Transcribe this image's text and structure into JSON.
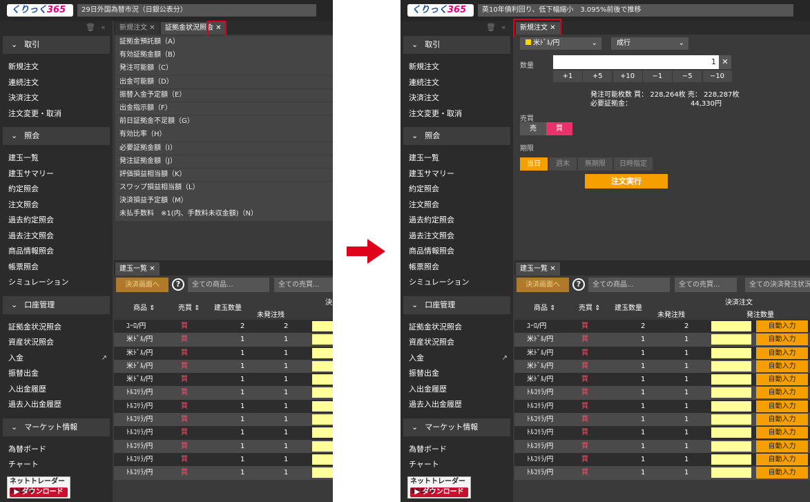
{
  "logo": {
    "brand": "くりっく",
    "num": "365"
  },
  "left": {
    "news": "29日外国為替市況（日銀公表分）",
    "tabs": [
      "新規注文",
      "証拠金状況照会"
    ],
    "columns": [
      "証拠金預託額（A）",
      "有効証拠金額（B）",
      "発注可能額（C）",
      "出金可能額（D）",
      "振替入金予定額（E）",
      "出金指示額（F）",
      "前日証拠金不足額（G）",
      "有効比率（H）",
      "必要証拠金額（I）",
      "発注証拠金額（J）",
      "評価損益相当額（K）",
      "スワップ損益相当額（L）",
      "決済損益予定額（M）",
      "未払手数料　※1(内、手数料未収金額)（N）"
    ],
    "toolbar": {
      "close_btn": "決済画面へ",
      "product": "全ての商品...",
      "side": "全ての売買..."
    },
    "header_cut": "決"
  },
  "right": {
    "news": "英10年債利回り、低下幅縮小　3.095%前後で推移",
    "tab": "新規注文",
    "form": {
      "pair": "米ﾄﾞﾙ/円",
      "order_type": "成行",
      "qty_label": "数量",
      "qty": "1",
      "steps": [
        "+1",
        "+5",
        "+10",
        "−1",
        "−5",
        "−10"
      ],
      "avail_label": "発注可能枚数 買：",
      "avail_buy": "228,264枚",
      "avail_sell_label": "売：",
      "avail_sell": "228,287枚",
      "margin_label": "必要証拠金：",
      "margin": "44,330円",
      "side_label": "売買",
      "sell": "売",
      "buy": "買",
      "period_label": "期限",
      "periods": [
        "当日",
        "週末",
        "無期限",
        "日時指定"
      ],
      "exec": "注文実行"
    },
    "toolbar": {
      "close_btn": "決済画面へ",
      "product": "全ての商品...",
      "side": "全ての売買...",
      "all": "全ての決済発注状況"
    },
    "header_top": "決済注文",
    "header_qty": "発注数量",
    "auto_btn": "自動入力"
  },
  "sidebar": {
    "sections": [
      {
        "title": "取引",
        "items": [
          "新規注文",
          "連続注文",
          "決済注文",
          "注文変更・取消"
        ]
      },
      {
        "title": "照会",
        "items": [
          "建玉一覧",
          "建玉サマリー",
          "約定照会",
          "注文照会",
          "過去約定照会",
          "過去注文照会",
          "商品情報照会",
          "帳票照会",
          "シミュレーション"
        ]
      },
      {
        "title": "口座管理",
        "items": [
          "証拠金状況照会",
          "資産状況照会",
          "入金",
          "振替出金",
          "入出金履歴",
          "過去入出金履歴"
        ]
      },
      {
        "title": "マーケット情報",
        "items": [
          "為替ボード",
          "チャート"
        ]
      }
    ],
    "download_top": "ネットトレーダー365FX",
    "download_btn": "ダウンロード"
  },
  "positions": {
    "tab": "建玉一覧",
    "headers": {
      "product": "商品",
      "side": "売買",
      "qty": "建玉数量",
      "unfilled": "未発注残"
    },
    "rows": [
      {
        "product": "ﾕｰﾛ/円",
        "side": "買",
        "qty": "2",
        "unfilled": "2"
      },
      {
        "product": "米ﾄﾞﾙ/円",
        "side": "買",
        "qty": "1",
        "unfilled": "1"
      },
      {
        "product": "米ﾄﾞﾙ/円",
        "side": "買",
        "qty": "1",
        "unfilled": "1"
      },
      {
        "product": "米ﾄﾞﾙ/円",
        "side": "買",
        "qty": "1",
        "unfilled": "1"
      },
      {
        "product": "米ﾄﾞﾙ/円",
        "side": "買",
        "qty": "1",
        "unfilled": "1"
      },
      {
        "product": "ﾄﾙｺﾘﾗ/円",
        "side": "買",
        "qty": "1",
        "unfilled": "1"
      },
      {
        "product": "ﾄﾙｺﾘﾗ/円",
        "side": "買",
        "qty": "1",
        "unfilled": "1"
      },
      {
        "product": "ﾄﾙｺﾘﾗ/円",
        "side": "買",
        "qty": "1",
        "unfilled": "1"
      },
      {
        "product": "ﾄﾙｺﾘﾗ/円",
        "side": "買",
        "qty": "1",
        "unfilled": "1"
      },
      {
        "product": "ﾄﾙｺﾘﾗ/円",
        "side": "買",
        "qty": "1",
        "unfilled": "1"
      },
      {
        "product": "ﾄﾙｺﾘﾗ/円",
        "side": "買",
        "qty": "1",
        "unfilled": "1"
      },
      {
        "product": "ﾄﾙｺﾘﾗ/円",
        "side": "買",
        "qty": "1",
        "unfilled": "1"
      }
    ]
  },
  "colors": {
    "accent": "#f5a000",
    "buy": "#ff4d6a",
    "highlight": "#e0001b"
  }
}
